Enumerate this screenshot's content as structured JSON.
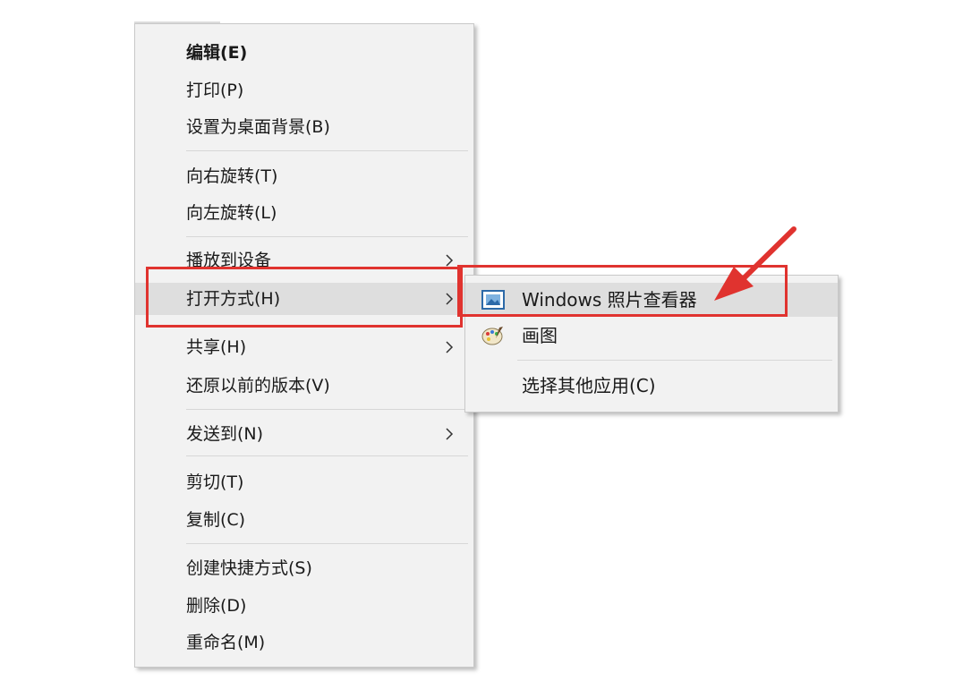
{
  "context_menu": {
    "items": [
      {
        "label": "编辑(E)",
        "bold": true
      },
      {
        "label": "打印(P)"
      },
      {
        "label": "设置为桌面背景(B)"
      },
      {
        "label": "向右旋转(T)"
      },
      {
        "label": "向左旋转(L)"
      },
      {
        "label": "播放到设备",
        "has_submenu": true
      },
      {
        "label": "打开方式(H)",
        "has_submenu": true,
        "highlighted": true
      },
      {
        "label": "共享(H)",
        "has_submenu": true
      },
      {
        "label": "还原以前的版本(V)"
      },
      {
        "label": "发送到(N)",
        "has_submenu": true
      },
      {
        "label": "剪切(T)"
      },
      {
        "label": "复制(C)"
      },
      {
        "label": "创建快捷方式(S)"
      },
      {
        "label": "删除(D)"
      },
      {
        "label": "重命名(M)"
      }
    ]
  },
  "open_with_submenu": {
    "items": [
      {
        "label": "Windows 照片查看器",
        "icon": "photo-viewer-icon",
        "highlighted": true
      },
      {
        "label": "画图",
        "icon": "paint-palette-icon"
      },
      {
        "label": "选择其他应用(C)",
        "icon": ""
      }
    ]
  },
  "annotation": {
    "highlight_color": "#e0332f",
    "arrow_color": "#e0332f"
  }
}
